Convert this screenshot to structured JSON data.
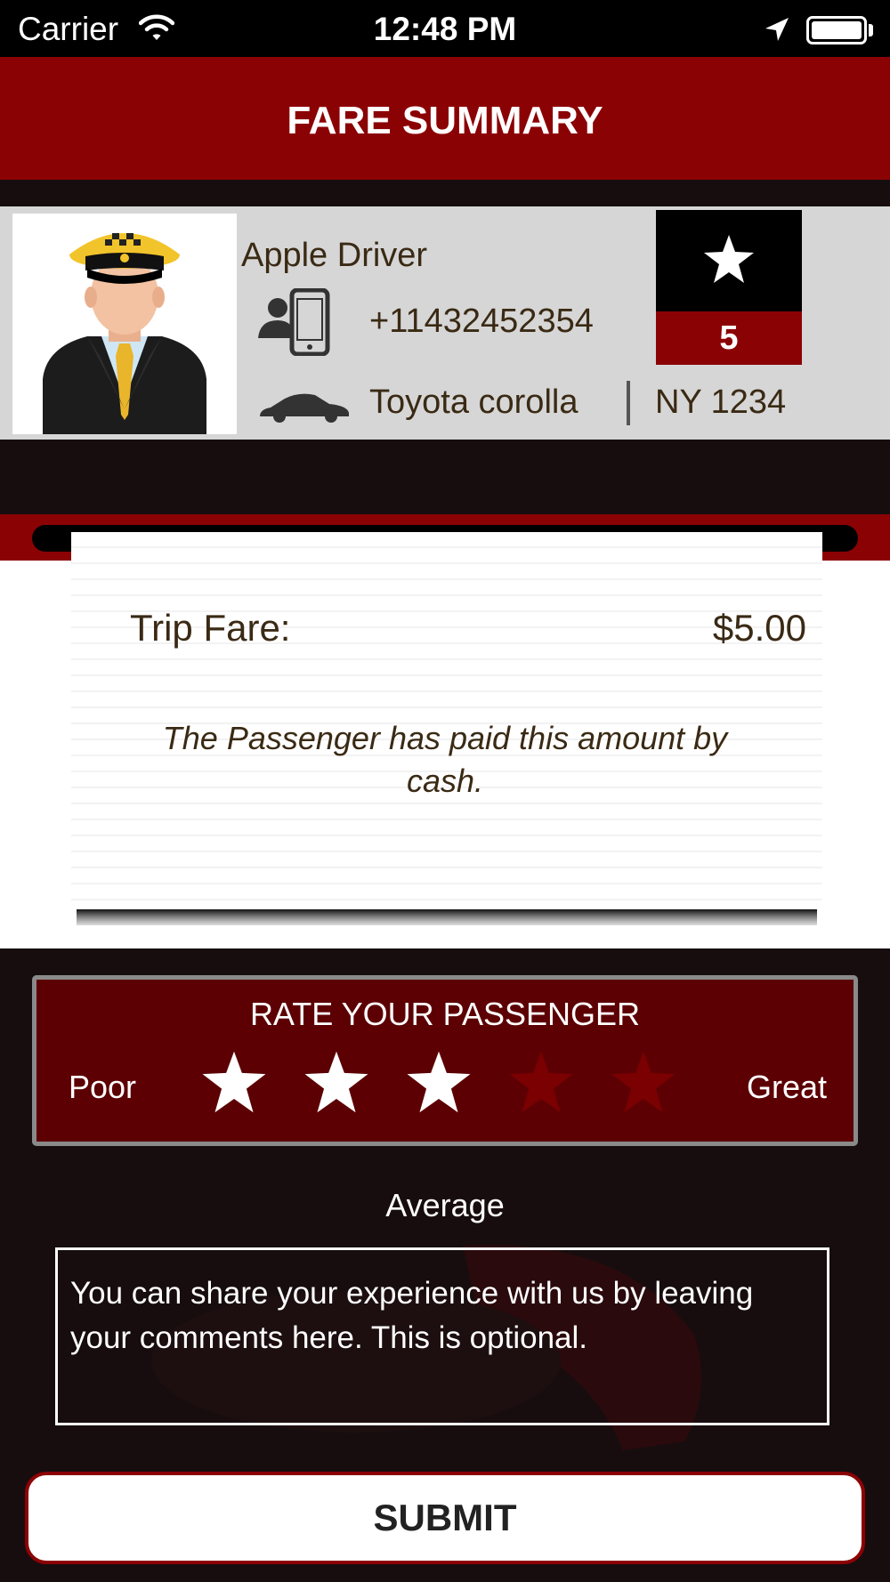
{
  "status_bar": {
    "carrier": "Carrier",
    "time": "12:48 PM"
  },
  "header": {
    "title": "FARE SUMMARY"
  },
  "driver": {
    "name": "Apple Driver",
    "phone": "+11432452354",
    "car_model": "Toyota corolla",
    "plate": "NY 1234",
    "rating": "5",
    "icons": [
      "driver-avatar",
      "phone-contact-icon",
      "car-icon",
      "star-icon"
    ]
  },
  "receipt": {
    "fare_label": "Trip Fare:",
    "fare_amount": "$5.00",
    "payment_note": "The Passenger has paid this amount by cash."
  },
  "rate_passenger": {
    "title": "RATE  YOUR PASSENGER",
    "low_label": "Poor",
    "high_label": "Great",
    "max_stars": 5,
    "selected_stars": 3,
    "rating_word": "Average"
  },
  "comments": {
    "placeholder": "You can share your experience with us by leaving your comments here. This is optional."
  },
  "submit": {
    "label": "SUBMIT"
  },
  "colors": {
    "brand_red": "#8b0205",
    "dark_bg": "#170d0f",
    "star_active": "#ffffff",
    "star_inactive": "#7a0002"
  }
}
